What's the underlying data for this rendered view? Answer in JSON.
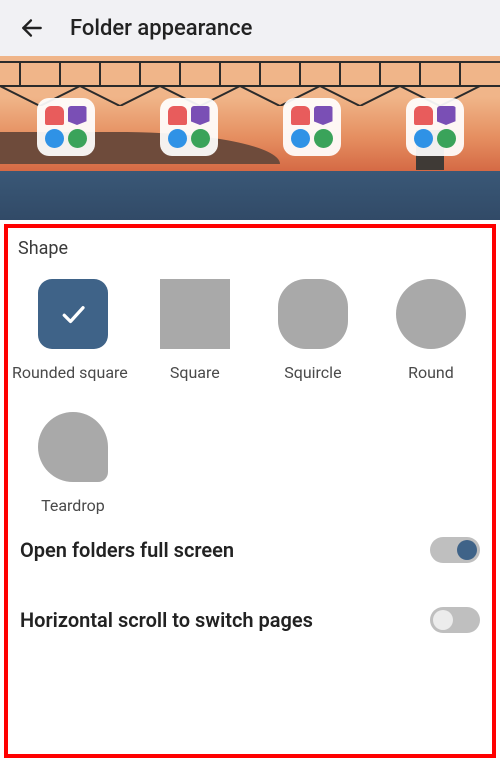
{
  "header": {
    "title": "Folder appearance"
  },
  "section": {
    "shape_label": "Shape"
  },
  "shapes": {
    "rounded_square": "Rounded square",
    "square": "Square",
    "squircle": "Squircle",
    "round": "Round",
    "teardrop": "Teardrop"
  },
  "shape_selected": "rounded_square",
  "toggles": {
    "full_screen": {
      "label": "Open folders full screen",
      "value": true
    },
    "horizontal_scroll": {
      "label": "Horizontal scroll to switch pages",
      "value": false
    }
  },
  "colors": {
    "accent": "#3f6388",
    "highlight": "#ff0000"
  }
}
